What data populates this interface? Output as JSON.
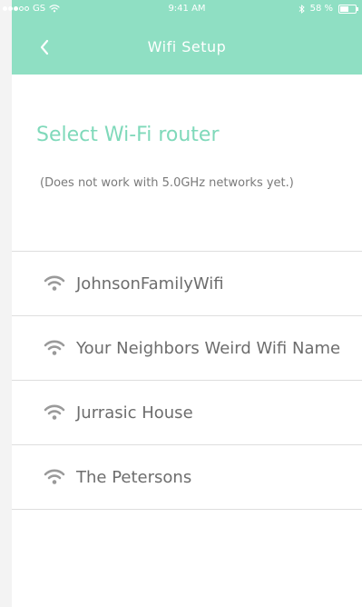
{
  "status_bar": {
    "carrier": "GS",
    "time": "9:41 AM",
    "battery_percent": "58 %",
    "battery_level": 0.58,
    "icons": [
      "signal-dots-icon",
      "wifi-status-icon",
      "bluetooth-icon",
      "battery-icon"
    ]
  },
  "header": {
    "title": "Wifi Setup",
    "back_icon": "chevron-left-icon"
  },
  "main": {
    "heading": "Select Wi-Fi router",
    "subtitle": "(Does not work with 5.0GHz networks yet.)"
  },
  "networks": [
    {
      "name": "JohnsonFamilyWifi",
      "icon": "wifi-icon"
    },
    {
      "name": "Your Neighbors Weird Wifi Name",
      "icon": "wifi-icon"
    },
    {
      "name": "Jurrasic House",
      "icon": "wifi-icon"
    },
    {
      "name": "The Petersons",
      "icon": "wifi-icon"
    }
  ],
  "colors": {
    "header_background": "#8fdfc3",
    "accent_text": "#7fd9ba",
    "list_text": "#6d6d6d",
    "divider": "#dedede",
    "wifi_icon": "#9a9a9a"
  }
}
